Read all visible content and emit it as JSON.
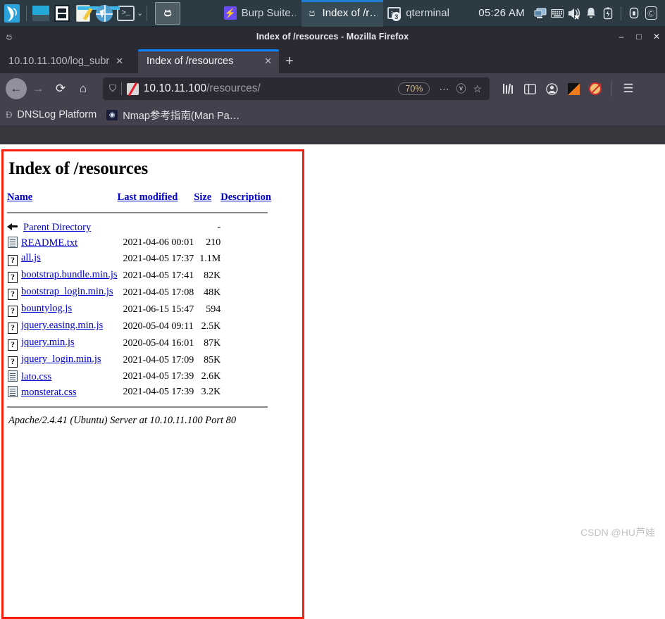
{
  "taskbar": {
    "launchers": [
      {
        "name": "kali-menu",
        "label": "Kali Menu"
      },
      {
        "name": "show-desktop",
        "label": "Show Desktop"
      },
      {
        "name": "file-manager",
        "label": "File Manager"
      },
      {
        "name": "text-editor",
        "label": "Text Editor"
      },
      {
        "name": "web-browser",
        "label": "Web Browser"
      },
      {
        "name": "terminal",
        "label": "Terminal"
      }
    ],
    "terminal_caret": "⌄",
    "active_launcher_glyph": "ප",
    "windows": [
      {
        "label": "Burp Suite…",
        "icon": "burp-icon",
        "icon_glyph": "⚡",
        "active": false
      },
      {
        "label": "Index of /r…",
        "icon": "firefox-icon",
        "icon_glyph": "ප",
        "active": true
      },
      {
        "label": "qterminal",
        "icon": "terminal-icon",
        "badge": "3",
        "active": false
      }
    ],
    "clock": "05:26 AM",
    "tray": [
      {
        "name": "display-icon",
        "glyph": "🖥"
      },
      {
        "name": "keyboard-icon",
        "glyph": "⌨"
      },
      {
        "name": "volume-muted-icon",
        "glyph": "🔈"
      },
      {
        "name": "notifications-bell-icon",
        "glyph": "🔔"
      },
      {
        "name": "battery-icon",
        "glyph": "🔋"
      },
      {
        "name": "lock-icon",
        "glyph": "🔒"
      },
      {
        "name": "clipboard-icon",
        "glyph": "ⓒ"
      }
    ]
  },
  "browser": {
    "title": "Index of /resources - Mozilla Firefox",
    "window_controls": {
      "minimize": "–",
      "maximize": "□",
      "close": "✕"
    },
    "tabs": [
      {
        "label": "10.10.11.100/log_subr",
        "close": "✕",
        "active": false
      },
      {
        "label": "Index of /resources",
        "close": "✕",
        "active": true
      }
    ],
    "new_tab_label": "+",
    "nav": {
      "back": "←",
      "forward": "→",
      "reload": "⟳",
      "home": "⌂"
    },
    "urlbar": {
      "shield_icon": "⛉",
      "noscript_icon": "noscript-blocked-icon",
      "host": "10.10.11.100",
      "path": "/resources/",
      "zoom_level": "70%",
      "page_actions": "⋯",
      "pocket": "ⓥ",
      "bookmark_star": "☆"
    },
    "toolbar_right": [
      {
        "name": "library-icon",
        "glyph": "‖‖"
      },
      {
        "name": "sidebar-icon",
        "glyph": "◫"
      },
      {
        "name": "account-icon",
        "glyph": "ⓘ"
      },
      {
        "name": "darkreader-icon",
        "glyph": ""
      },
      {
        "name": "noscript-icon",
        "glyph": ""
      },
      {
        "name": "menu-icon",
        "glyph": "☰"
      }
    ],
    "bookmarks": [
      {
        "label": "DNSLog Platform",
        "icon": "dnslog-icon",
        "glyph": "Ɖ"
      },
      {
        "label": "Nmap参考指南(Man Pa…",
        "icon": "nmap-icon",
        "glyph": "◉"
      }
    ]
  },
  "page": {
    "heading": "Index of /resources",
    "columns": {
      "name": "Name",
      "last_modified": "Last modified",
      "size": "Size",
      "description": "Description"
    },
    "parent": {
      "label": "Parent Directory",
      "icon": "parent-directory-icon",
      "last_modified": "",
      "size": "-",
      "description": ""
    },
    "entries": [
      {
        "name": "README.txt",
        "icon": "text-file-icon",
        "last_modified": "2021-04-06 00:01",
        "size": "210",
        "description": ""
      },
      {
        "name": "all.js",
        "icon": "unknown-file-icon",
        "last_modified": "2021-04-05 17:37",
        "size": "1.1M",
        "description": ""
      },
      {
        "name": "bootstrap.bundle.min.js",
        "icon": "unknown-file-icon",
        "last_modified": "2021-04-05 17:41",
        "size": "82K",
        "description": ""
      },
      {
        "name": "bootstrap_login.min.js",
        "icon": "unknown-file-icon",
        "last_modified": "2021-04-05 17:08",
        "size": "48K",
        "description": ""
      },
      {
        "name": "bountylog.js",
        "icon": "unknown-file-icon",
        "last_modified": "2021-06-15 15:47",
        "size": "594",
        "description": ""
      },
      {
        "name": "jquery.easing.min.js",
        "icon": "unknown-file-icon",
        "last_modified": "2020-05-04 09:11",
        "size": "2.5K",
        "description": ""
      },
      {
        "name": "jquery.min.js",
        "icon": "unknown-file-icon",
        "last_modified": "2020-05-04 16:01",
        "size": "87K",
        "description": ""
      },
      {
        "name": "jquery_login.min.js",
        "icon": "unknown-file-icon",
        "last_modified": "2021-04-05 17:09",
        "size": "85K",
        "description": ""
      },
      {
        "name": "lato.css",
        "icon": "text-file-icon",
        "last_modified": "2021-04-05 17:39",
        "size": "2.6K",
        "description": ""
      },
      {
        "name": "monsterat.css",
        "icon": "text-file-icon",
        "last_modified": "2021-04-05 17:39",
        "size": "3.2K",
        "description": ""
      }
    ],
    "footer": "Apache/2.4.41 (Ubuntu) Server at 10.10.11.100 Port 80",
    "unknown_icon_glyph": "?"
  },
  "watermark": "CSDN @HU芦娃",
  "colors": {
    "accent_blue": "#0a84ff",
    "taskbar_bg": "#2b3a43",
    "chrome_bg": "#42414d",
    "titlebar_bg": "#2b2a33",
    "link_blue": "#0000cc",
    "link_visited": "#551a8b",
    "highlight_red": "#fa1e0e"
  }
}
